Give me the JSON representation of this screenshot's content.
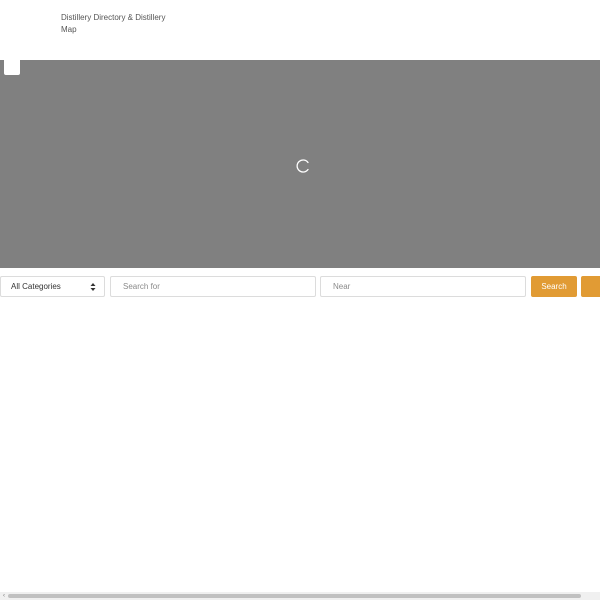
{
  "header": {
    "site_title": "Distillery Directory & Distillery Map"
  },
  "map": {
    "loading_icon": "spinner-icon"
  },
  "search": {
    "category_selected": "All Categories",
    "search_placeholder": "Search for",
    "near_placeholder": "Near",
    "search_button_label": "Search",
    "accent_color": "#e19b34"
  },
  "scrollbar": {
    "left_arrow_icon": "chevron-left-icon"
  }
}
